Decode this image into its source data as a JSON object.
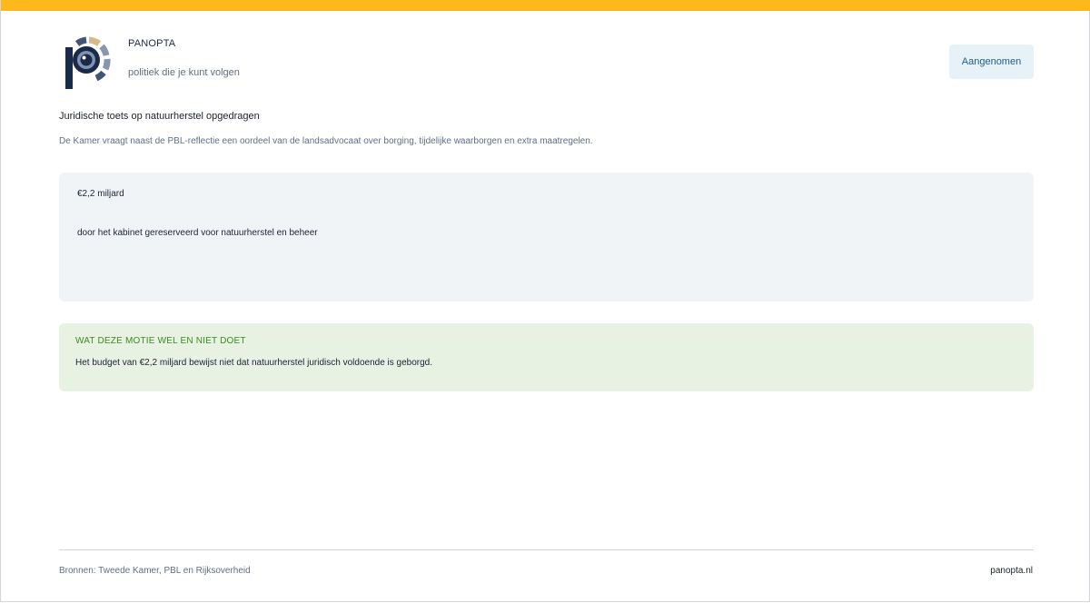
{
  "header": {
    "brand": "PANOPTA",
    "tagline": "politiek die je kunt volgen",
    "status": "Aangenomen",
    "logo_icon": "panopta-eye-logo-icon"
  },
  "motion": {
    "title": "Juridische toets op natuurherstel opgedragen",
    "description": "De Kamer vraagt naast de PBL-reflectie een oordeel van de landsadvocaat over borging, tijdelijke waarborgen en extra maatregelen."
  },
  "stat": {
    "value": "€2,2 miljard",
    "label": "door het kabinet gereserveerd voor natuurherstel en beheer"
  },
  "note": {
    "heading": "WAT DEZE MOTIE WEL EN NIET DOET",
    "text": "Het budget van €2,2 miljard bewijst niet dat natuurherstel juridisch voldoende is geborgd."
  },
  "footer": {
    "sources": "Bronnen: Tweede Kamer, PBL en Rijksoverheid",
    "site": "panopta.nl"
  },
  "colors": {
    "accent_bar": "#fdb81e",
    "brand_navy": "#1c2a4a",
    "badge_bg": "#e6f1f8",
    "note_bg": "#e8f2e3",
    "note_heading": "#3b8a1f"
  }
}
